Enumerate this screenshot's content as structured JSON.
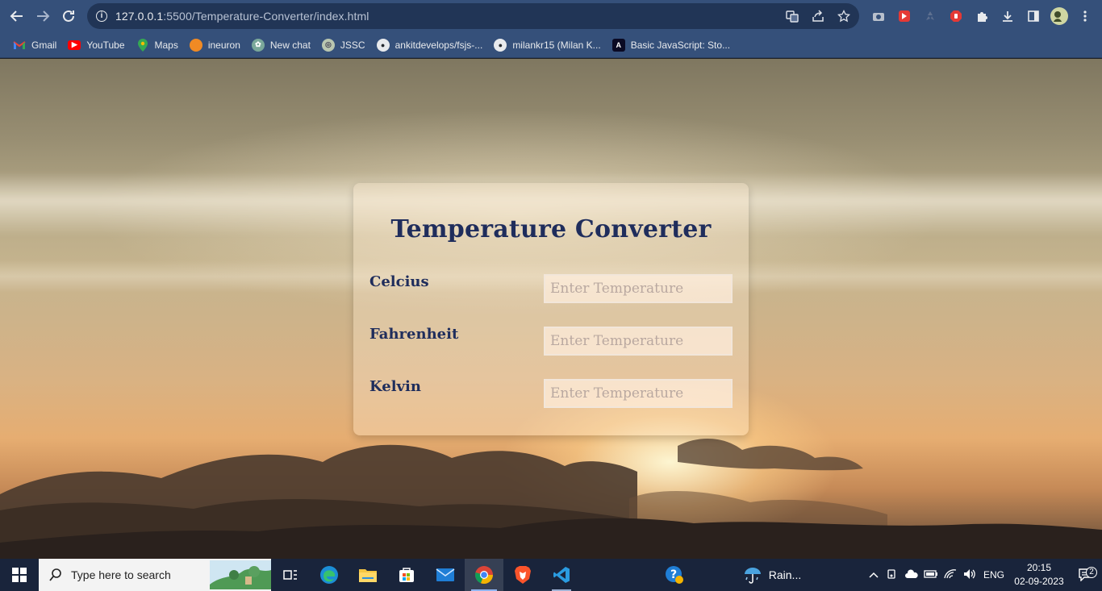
{
  "browser": {
    "url_host": "127.0.0.1",
    "url_rest": ":5500/Temperature-Converter/index.html",
    "bookmarks": [
      {
        "label": "Gmail"
      },
      {
        "label": "YouTube"
      },
      {
        "label": "Maps"
      },
      {
        "label": "ineuron"
      },
      {
        "label": "New chat"
      },
      {
        "label": "JSSC"
      },
      {
        "label": "ankitdevelops/fsjs-..."
      },
      {
        "label": "milankr15 (Milan K..."
      },
      {
        "label": "Basic JavaScript: Sto..."
      }
    ]
  },
  "converter": {
    "title": "Temperature Converter",
    "fields": [
      {
        "label": "Celcius",
        "placeholder": "Enter Temperature"
      },
      {
        "label": "Fahrenheit",
        "placeholder": "Enter Temperature"
      },
      {
        "label": "Kelvin",
        "placeholder": "Enter Temperature"
      }
    ]
  },
  "taskbar": {
    "search_placeholder": "Type here to search",
    "weather": "Rain...",
    "language": "ENG",
    "time": "20:15",
    "date": "02-09-2023",
    "notification_count": "2"
  }
}
